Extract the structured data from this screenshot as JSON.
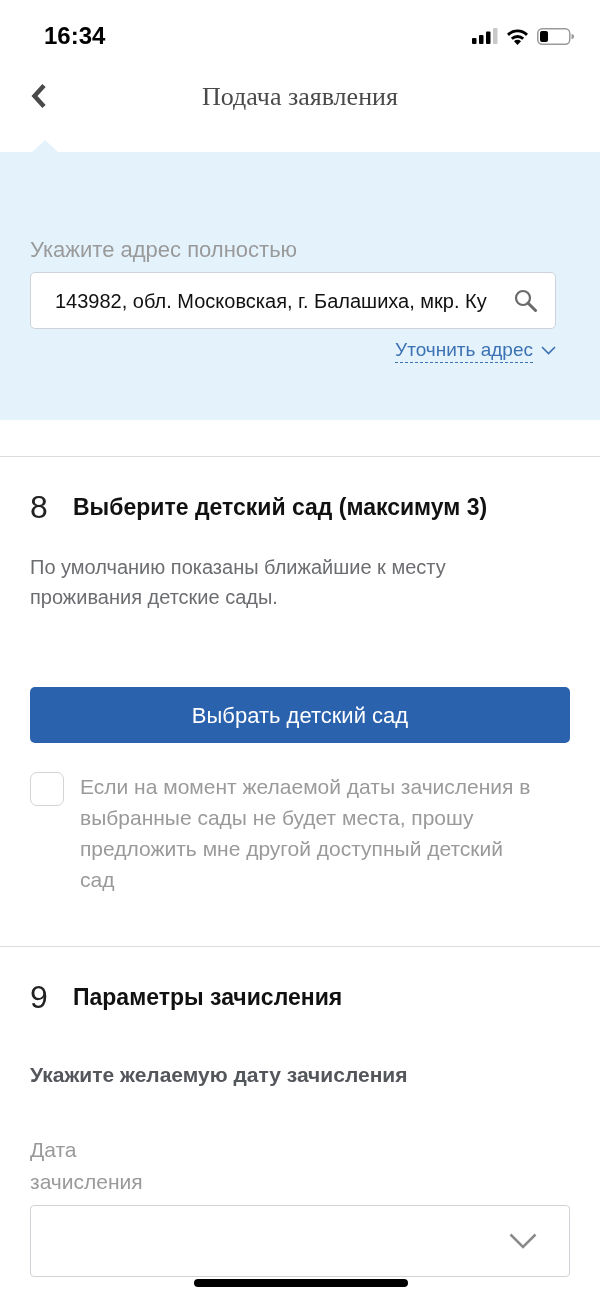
{
  "status_bar": {
    "time": "16:34"
  },
  "header": {
    "title": "Подача заявления"
  },
  "address": {
    "label": "Укажите адрес полностью",
    "value": "143982, обл. Московская, г. Балашиха, мкр. Ку",
    "refine_link": "Уточнить адрес"
  },
  "sections": [
    {
      "number": "8",
      "title": "Выберите детский сад (максимум 3)",
      "items": [
        {
          "kind": "note",
          "text": "По умолчанию показаны ближайшие к месту проживания детские сады."
        },
        {
          "kind": "button",
          "label": "Выбрать детский сад"
        },
        {
          "kind": "checkbox",
          "label": "Если на момент желаемой даты зачисления в выбранные сады не будет места, прошу предложить мне другой доступный детский сад",
          "checked": false
        }
      ]
    },
    {
      "number": "9",
      "title": "Параметры зачисления",
      "items": [
        {
          "kind": "subheading",
          "text": "Укажите желаемую дату зачисления"
        },
        {
          "kind": "select",
          "label": "Дата зачисления"
        }
      ]
    }
  ]
}
